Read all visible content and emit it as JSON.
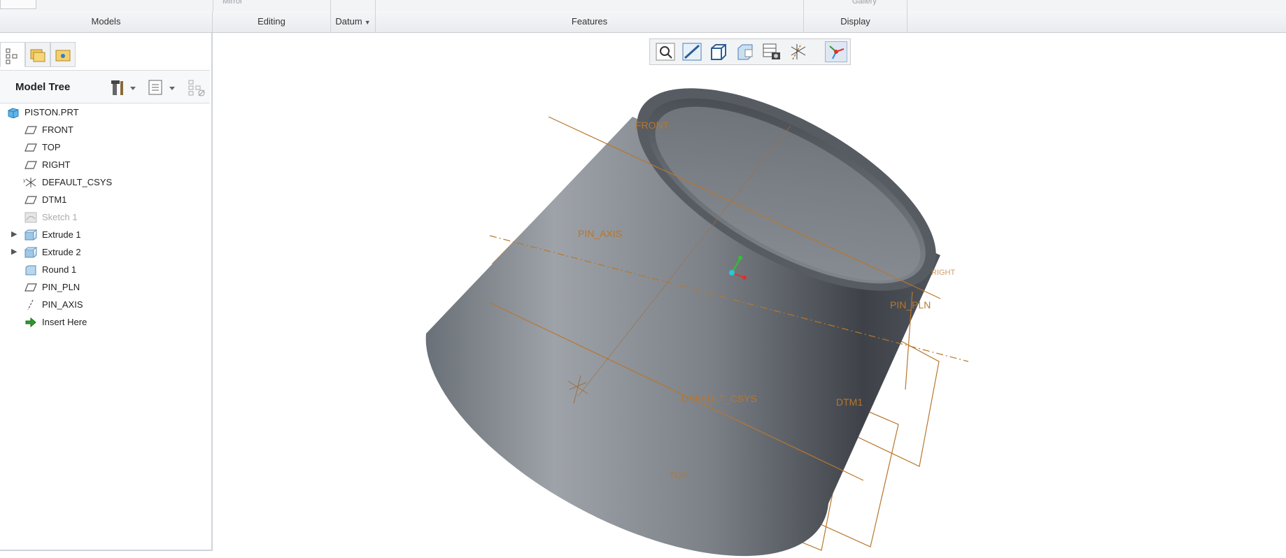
{
  "ribbon": {
    "top_partial": {
      "mirror": "Mirror",
      "gallery": "Gallery"
    },
    "groups": [
      {
        "label": "Models"
      },
      {
        "label": "Editing"
      },
      {
        "label": "Datum",
        "dropdown": true
      },
      {
        "label": "Features"
      },
      {
        "label": "Display"
      }
    ]
  },
  "left_panel": {
    "tabs": [
      "model-tree-tab",
      "folder-browser-tab",
      "favorites-tab"
    ],
    "header": {
      "title": "Model Tree"
    },
    "tree": [
      {
        "label": "PISTON.PRT",
        "icon": "part-icon",
        "expandable": false,
        "indent": 0
      },
      {
        "label": "FRONT",
        "icon": "datum-plane-icon",
        "expandable": false,
        "indent": 1
      },
      {
        "label": "TOP",
        "icon": "datum-plane-icon",
        "expandable": false,
        "indent": 1
      },
      {
        "label": "RIGHT",
        "icon": "datum-plane-icon",
        "expandable": false,
        "indent": 1
      },
      {
        "label": "DEFAULT_CSYS",
        "icon": "csys-icon",
        "expandable": false,
        "indent": 1
      },
      {
        "label": "DTM1",
        "icon": "datum-plane-icon",
        "expandable": false,
        "indent": 1
      },
      {
        "label": "Sketch 1",
        "icon": "sketch-icon",
        "expandable": false,
        "indent": 1,
        "dimmed": true
      },
      {
        "label": "Extrude 1",
        "icon": "extrude-icon",
        "expandable": true,
        "indent": 1
      },
      {
        "label": "Extrude 2",
        "icon": "extrude-icon",
        "expandable": true,
        "indent": 1
      },
      {
        "label": "Round 1",
        "icon": "round-icon",
        "expandable": false,
        "indent": 1
      },
      {
        "label": "PIN_PLN",
        "icon": "datum-plane-icon",
        "expandable": false,
        "indent": 1
      },
      {
        "label": "PIN_AXIS",
        "icon": "datum-axis-icon",
        "expandable": false,
        "indent": 1
      },
      {
        "label": "Insert Here",
        "icon": "insert-arrow-icon",
        "expandable": false,
        "indent": 1
      }
    ]
  },
  "view_toolbar": [
    {
      "name": "refit-icon"
    },
    {
      "name": "zoom-in-icon"
    },
    {
      "name": "saved-orientations-icon"
    },
    {
      "name": "display-style-icon"
    },
    {
      "name": "view-manager-icon"
    },
    {
      "name": "datum-display-filters-icon"
    },
    {
      "name": "spin-center-icon",
      "active": true
    }
  ],
  "model_labels": {
    "front": "FRONT",
    "pin_axis": "PIN_AXIS",
    "pin_pln": "PIN_PLN",
    "default_csys": "DEFAULT_CSYS",
    "dtm1": "DTM1",
    "top": "TOP",
    "right": "RIGHT"
  },
  "colors": {
    "datum": "#b8762c",
    "body_light": "#9ea3a9",
    "body_dark": "#3e4248",
    "csys_x": "#e0302c",
    "csys_y": "#2ec42a",
    "csys_z": "#27c8d6"
  }
}
